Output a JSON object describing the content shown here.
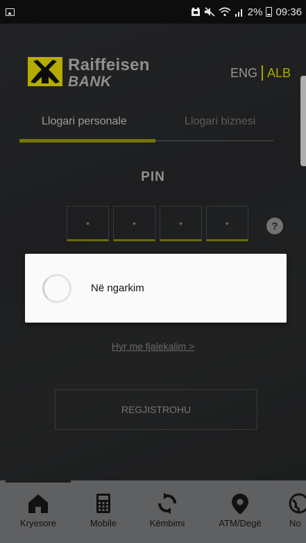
{
  "status_bar": {
    "time": "09:36",
    "battery_percent": "2%",
    "icons": [
      "image-icon",
      "alarm-icon",
      "mute-icon",
      "wifi-icon",
      "signal-icon",
      "battery-icon"
    ]
  },
  "header": {
    "logo_line1": "Raiffeisen",
    "logo_line2": "BANK",
    "lang_eng": "ENG",
    "lang_alb": "ALB"
  },
  "tabs": [
    {
      "label": "Llogari personale",
      "active": true
    },
    {
      "label": "Llogari biznesi",
      "active": false
    }
  ],
  "pin": {
    "label": "PIN",
    "digits": [
      "•",
      "•",
      "•",
      "•"
    ],
    "help": "?"
  },
  "login_password_link": "Hyr me fjalekalim >",
  "register_button": "REGJISTROHU",
  "dialog": {
    "message": "Në ngarkim"
  },
  "bottom_nav": [
    {
      "label": "Kryesore",
      "icon": "home-icon",
      "active": true
    },
    {
      "label": "Mobile",
      "icon": "calculator-icon",
      "active": false
    },
    {
      "label": "Këmbimi",
      "icon": "exchange-icon",
      "active": false
    },
    {
      "label": "ATM/Degë",
      "icon": "location-pin-icon",
      "active": false
    },
    {
      "label": "No",
      "icon": "globe-icon",
      "active": false
    }
  ],
  "colors": {
    "accent": "#e8e000",
    "tab_underline": "#9c9b0c",
    "nav_background": "#5f6062",
    "page_background": "#2a2b2c"
  }
}
